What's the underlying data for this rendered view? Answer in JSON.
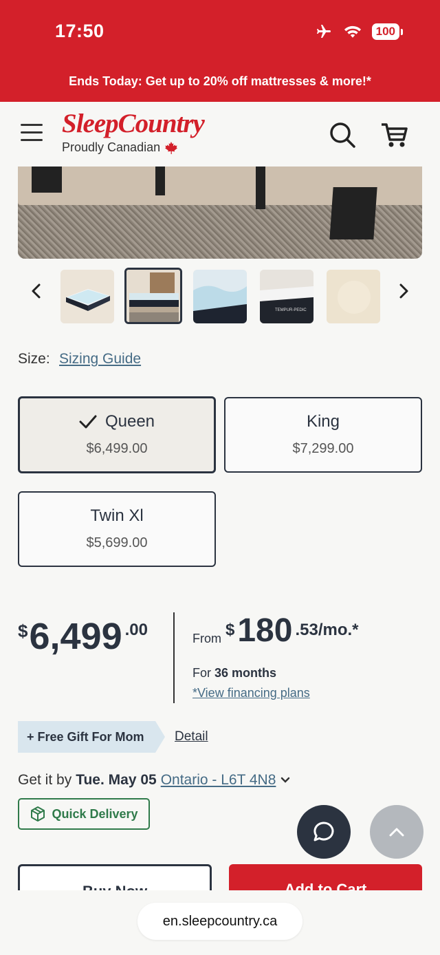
{
  "status_bar": {
    "time": "17:50",
    "battery": "100"
  },
  "promo": {
    "text": "Ends Today: Get up to 20% off mattresses & more!*"
  },
  "header": {
    "logo_main": "SleepCountry",
    "logo_sub": "Proudly Canadian"
  },
  "size": {
    "label": "Size:",
    "guide": "Sizing Guide",
    "options": [
      {
        "name": "Queen",
        "price": "$6,499.00",
        "selected": true
      },
      {
        "name": "King",
        "price": "$7,299.00",
        "selected": false
      },
      {
        "name": "Twin Xl",
        "price": "$5,699.00",
        "selected": false
      }
    ]
  },
  "price": {
    "currency": "$",
    "integer": "6,499",
    "cents": ".00"
  },
  "financing": {
    "from": "From",
    "currency": "$",
    "integer": "180",
    "cents": ".53/mo.*",
    "term_prefix": "For",
    "term": "36 months",
    "link": "*View financing plans"
  },
  "gift": {
    "tag": "+ Free Gift For Mom",
    "detail": "Detail"
  },
  "delivery": {
    "prefix": "Get it by",
    "date": "Tue. May 05",
    "location": "Ontario - L6T 4N8",
    "badge": "Quick Delivery"
  },
  "actions": {
    "buy_now": "Buy Now",
    "add_to_cart": "Add to Cart"
  },
  "browser": {
    "url": "en.sleepcountry.ca"
  },
  "colors": {
    "brand_red": "#d3202a",
    "navy": "#2b3340",
    "link": "#456b85",
    "green": "#2f7a4a"
  }
}
